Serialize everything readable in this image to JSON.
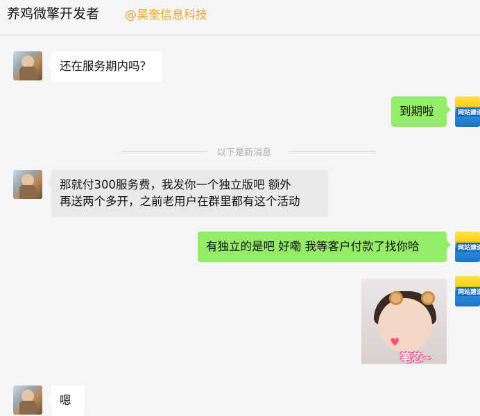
{
  "header": {
    "title": "养鸡微擎开发者",
    "company": "@昊奎信息科技"
  },
  "divider": {
    "text": "以下是新消息"
  },
  "messages": [
    {
      "side": "left",
      "text": "还在服务期内吗？"
    },
    {
      "side": "right",
      "text": "到期啦"
    },
    {
      "side": "left",
      "line1": "那就付300服务费，我发你一个独立版吧   额外",
      "line2": "再送两个多开，之前老用户在群里都有这个活动"
    },
    {
      "side": "right",
      "text": "有独立的是吧 好嘞 我等客户付款了找你哈"
    },
    {
      "side": "right",
      "sticker_caption": "笔芯~"
    },
    {
      "side": "left",
      "text": "嗯"
    }
  ],
  "avatars": {
    "right_text": "网站建设"
  },
  "colors": {
    "company": "#f0a030",
    "green_bubble": "#95ec69",
    "white_bubble": "#ffffff",
    "gray_bubble": "#e9e9e9"
  }
}
